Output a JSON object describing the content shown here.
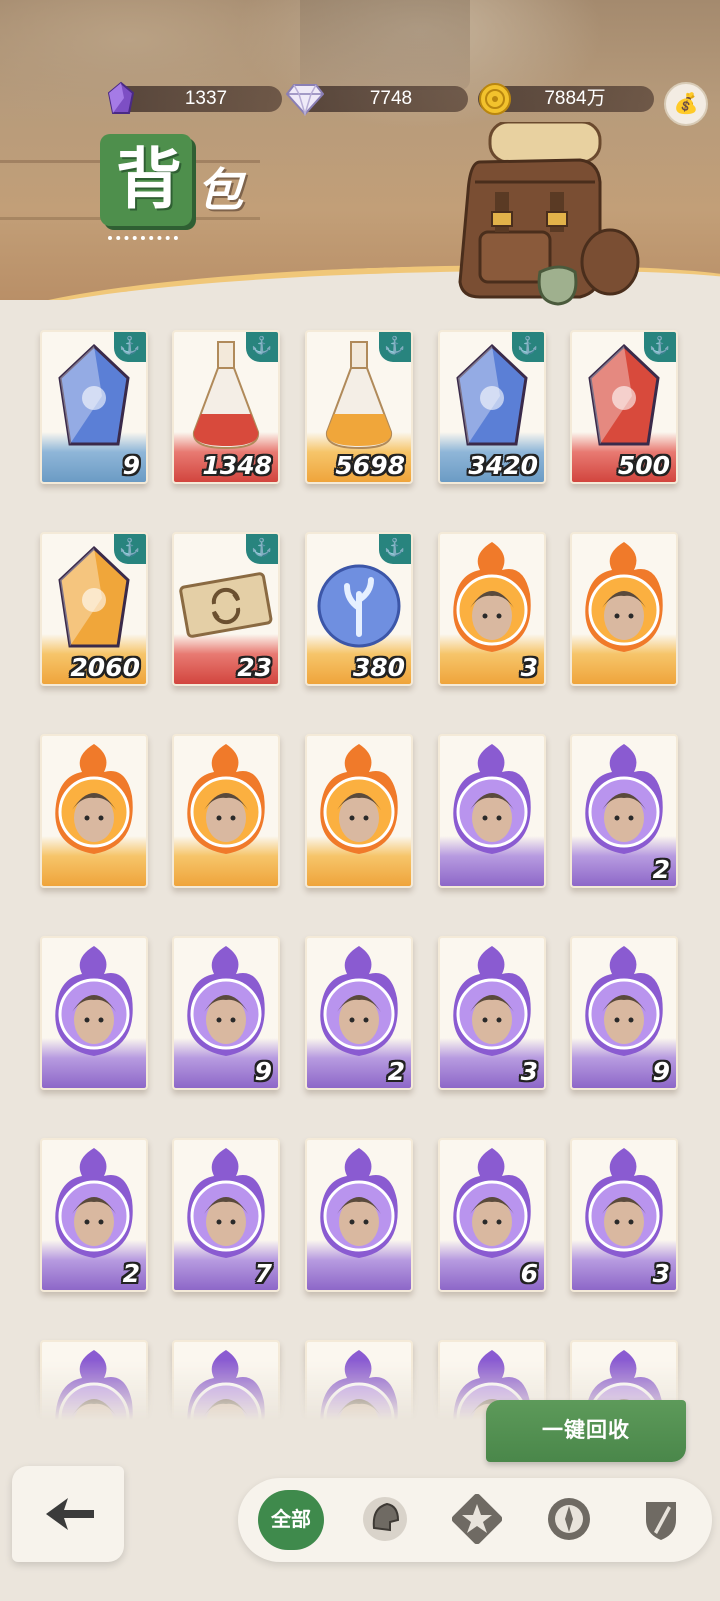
{
  "header": {
    "title_char1": "背",
    "title_char2": "包",
    "currencies": [
      {
        "icon": "purple-crystal-icon",
        "value": "1337"
      },
      {
        "icon": "diamond-icon",
        "value": "7748"
      },
      {
        "icon": "gold-coin-icon",
        "value": "7884万"
      }
    ],
    "bag_button_icon": "money-bag-icon"
  },
  "items": [
    {
      "icon": "blue-gem-shard",
      "rarity": "blue",
      "qty": "9",
      "locked": true
    },
    {
      "icon": "red-potion-bottle",
      "rarity": "red",
      "qty": "1348",
      "locked": true
    },
    {
      "icon": "yellow-potion-bottle",
      "rarity": "orange",
      "qty": "5698",
      "locked": true
    },
    {
      "icon": "sun-moon-orb",
      "rarity": "blue",
      "qty": "3420",
      "locked": true
    },
    {
      "icon": "red-dragon-eye-gem",
      "rarity": "red",
      "qty": "500",
      "locked": true
    },
    {
      "icon": "golden-egg-gem",
      "rarity": "orange",
      "qty": "2060",
      "locked": true
    },
    {
      "icon": "exchange-ticket",
      "rarity": "red",
      "qty": "23",
      "locked": true
    },
    {
      "icon": "blue-coral-coin",
      "rarity": "orange",
      "qty": "380",
      "locked": true
    },
    {
      "icon": "hero-portrait-demon-blue",
      "rarity": "orange",
      "qty": "3",
      "locked": false
    },
    {
      "icon": "hero-portrait-white-hair",
      "rarity": "orange",
      "qty": "",
      "locked": false
    },
    {
      "icon": "hero-portrait-beast",
      "rarity": "orange",
      "qty": "",
      "locked": false
    },
    {
      "icon": "hero-portrait-dark-lady",
      "rarity": "orange",
      "qty": "",
      "locked": false
    },
    {
      "icon": "hero-portrait-elf",
      "rarity": "orange",
      "qty": "",
      "locked": false
    },
    {
      "icon": "hero-portrait-blonde",
      "rarity": "purple",
      "qty": "",
      "locked": false
    },
    {
      "icon": "hero-portrait-treant",
      "rarity": "purple",
      "qty": "2",
      "locked": false
    },
    {
      "icon": "hero-portrait-hatted-man",
      "rarity": "purple",
      "qty": "",
      "locked": false
    },
    {
      "icon": "hero-portrait-sun-priestess",
      "rarity": "purple",
      "qty": "9",
      "locked": false
    },
    {
      "icon": "hero-portrait-goblin",
      "rarity": "purple",
      "qty": "2",
      "locked": false
    },
    {
      "icon": "hero-portrait-curly-kid",
      "rarity": "purple",
      "qty": "3",
      "locked": false
    },
    {
      "icon": "hero-portrait-girl",
      "rarity": "purple",
      "qty": "9",
      "locked": false
    },
    {
      "icon": "hero-portrait-elf-maiden",
      "rarity": "purple",
      "qty": "2",
      "locked": false
    },
    {
      "icon": "hero-portrait-eyepatch",
      "rarity": "purple",
      "qty": "7",
      "locked": false
    },
    {
      "icon": "hero-portrait-silver-hair",
      "rarity": "purple",
      "qty": "",
      "locked": false
    },
    {
      "icon": "hero-portrait-dark-knight",
      "rarity": "purple",
      "qty": "6",
      "locked": false
    },
    {
      "icon": "hero-portrait-red-hair",
      "rarity": "purple",
      "qty": "3",
      "locked": false
    },
    {
      "icon": "hero-portrait-bird-mask",
      "rarity": "purple",
      "qty": "",
      "locked": false
    },
    {
      "icon": "hero-portrait-warrior",
      "rarity": "purple",
      "qty": "",
      "locked": false
    },
    {
      "icon": "hero-portrait-crowned",
      "rarity": "purple",
      "qty": "",
      "locked": false
    },
    {
      "icon": "hero-portrait-pink",
      "rarity": "purple",
      "qty": "",
      "locked": false
    },
    {
      "icon": "hero-portrait-mystic",
      "rarity": "purple",
      "qty": "",
      "locked": false
    }
  ],
  "actions": {
    "recycle_label": "一键回收",
    "back_icon": "back-arrow-icon"
  },
  "filters": [
    {
      "label": "全部",
      "icon": "",
      "active": true
    },
    {
      "label": "",
      "icon": "helmet-icon",
      "active": false
    },
    {
      "label": "",
      "icon": "star-badge-icon",
      "active": false
    },
    {
      "label": "",
      "icon": "compass-icon",
      "active": false
    },
    {
      "label": "",
      "icon": "sword-shield-icon",
      "active": false
    }
  ],
  "colors": {
    "accent_green": "#4e8f4c",
    "lock_teal": "#28847e",
    "rarity_blue": "#6b9bc4",
    "rarity_red": "#d2453e",
    "rarity_orange": "#efa43b",
    "rarity_purple": "#8d67c8"
  }
}
